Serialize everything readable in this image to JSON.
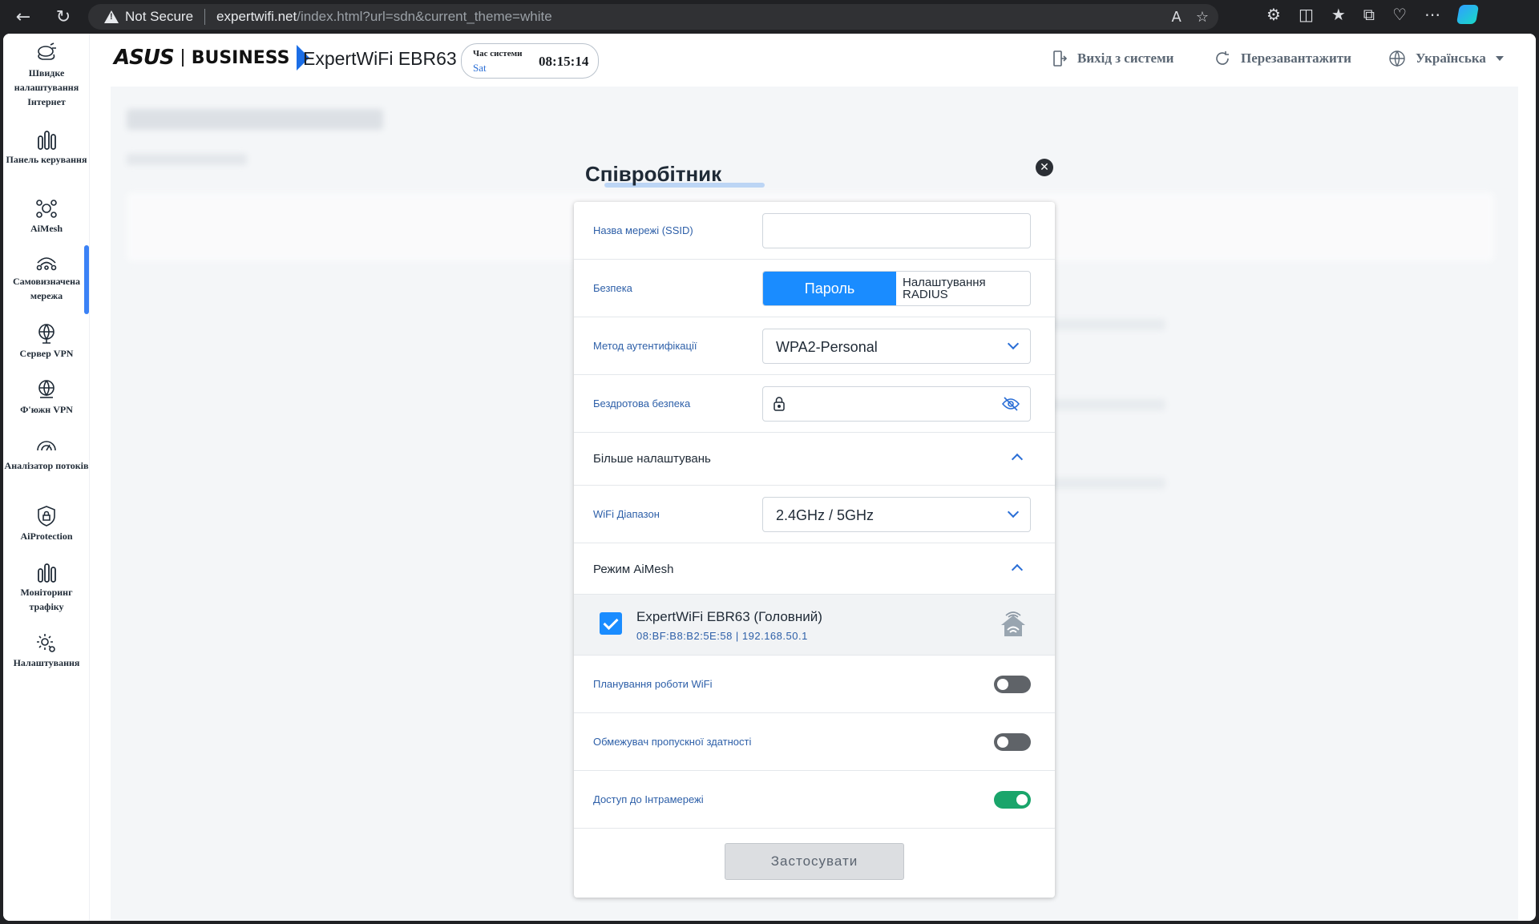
{
  "browser": {
    "security": "Not Secure",
    "url_host": "expertwifi.net",
    "url_path": "/index.html?url=sdn&current_theme=white"
  },
  "sidebar": {
    "items": [
      {
        "label": "Швидке налаштування Інтернет",
        "icon": "quick-setup-icon"
      },
      {
        "label": "Панель керування",
        "icon": "dashboard-icon"
      },
      {
        "label": "AiMesh",
        "icon": "aimesh-icon"
      },
      {
        "label": "Самовизначена мережа",
        "icon": "custom-network-icon"
      },
      {
        "label": "Сервер VPN",
        "icon": "vpn-server-icon"
      },
      {
        "label": "Ф'южн VPN",
        "icon": "fusion-vpn-icon"
      },
      {
        "label": "Аналізатор потоків",
        "icon": "flow-analyzer-icon"
      },
      {
        "label": "AiProtection",
        "icon": "shield-icon"
      },
      {
        "label": "Моніторинг трафіку",
        "icon": "traffic-monitor-icon"
      },
      {
        "label": "Налаштування",
        "icon": "settings-icon"
      }
    ],
    "active_index": 3
  },
  "header": {
    "brand": "ASUS",
    "brand_sub": "BUSINESS",
    "model": "ExpertWiFi EBR63",
    "time_label": "Час системи",
    "day": "Sat",
    "time": "08:15:14",
    "logout": "Вихід з системи",
    "reboot": "Перезавантажити",
    "language": "Українська"
  },
  "modal": {
    "title": "Співробітник",
    "ssid_label": "Назва мережі (SSID)",
    "ssid_value": "",
    "security_label": "Безпека",
    "security_on": "Пароль",
    "security_off": "Налаштування RADIUS",
    "auth_label": "Метод аутентифікації",
    "auth_value": "WPA2-Personal",
    "wireless_label": "Бездротова безпека",
    "wireless_value": "",
    "more_settings": "Більше налаштувань",
    "band_label": "WiFi Діапазон",
    "band_value": "2.4GHz / 5GHz",
    "aimesh_mode": "Режим AiMesh",
    "node_name": "ExpertWiFi EBR63 (Головний)",
    "node_mac": "08:BF:B8:B2:5E:58 | 192.168.50.1",
    "schedule_label": "Планування роботи WiFi",
    "schedule_on": false,
    "bandwidth_label": "Обмежувач пропускної здатності",
    "bandwidth_on": false,
    "intranet_label": "Доступ до Інтрамережі",
    "intranet_on": true,
    "apply": "Застосувати"
  },
  "colors": {
    "accent": "#1a8cff",
    "toggle_on": "#1aa56b",
    "toggle_off": "#5f6368"
  }
}
